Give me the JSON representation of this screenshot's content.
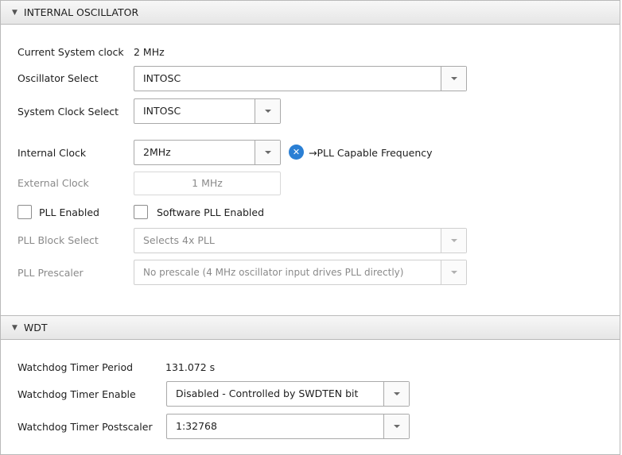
{
  "osc": {
    "title": "INTERNAL OSCILLATOR",
    "current_clock_label": "Current System clock",
    "current_clock_value": "2 MHz",
    "osc_select_label": "Oscillator Select",
    "osc_select_value": "INTOSC",
    "sys_clock_label": "System Clock Select",
    "sys_clock_value": "INTOSC",
    "internal_clock_label": "Internal Clock",
    "internal_clock_value": "2MHz",
    "pll_capable_text": "→PLL Capable Frequency",
    "external_clock_label": "External Clock",
    "external_clock_value": "1 MHz",
    "pll_enabled_label": "PLL Enabled",
    "pll_enabled_checked": false,
    "sw_pll_label": "Software PLL Enabled",
    "sw_pll_checked": false,
    "pll_block_label": "PLL Block Select",
    "pll_block_value": "Selects 4x PLL",
    "pll_prescaler_label": "PLL Prescaler",
    "pll_prescaler_value": "No prescale (4 MHz oscillator input drives PLL directly)"
  },
  "wdt": {
    "title": "WDT",
    "period_label": "Watchdog Timer Period",
    "period_value": "131.072 s",
    "enable_label": "Watchdog Timer Enable",
    "enable_value": "Disabled - Controlled by SWDTEN bit",
    "postscaler_label": "Watchdog Timer Postscaler",
    "postscaler_value": "1:32768"
  },
  "icons": {
    "collapse": "triangle-down-icon",
    "dropdown": "chevron-down-icon",
    "info": "close-circle-icon"
  },
  "colors": {
    "info_blue": "#2a7fd4",
    "disabled_text": "#8a8a8a"
  }
}
